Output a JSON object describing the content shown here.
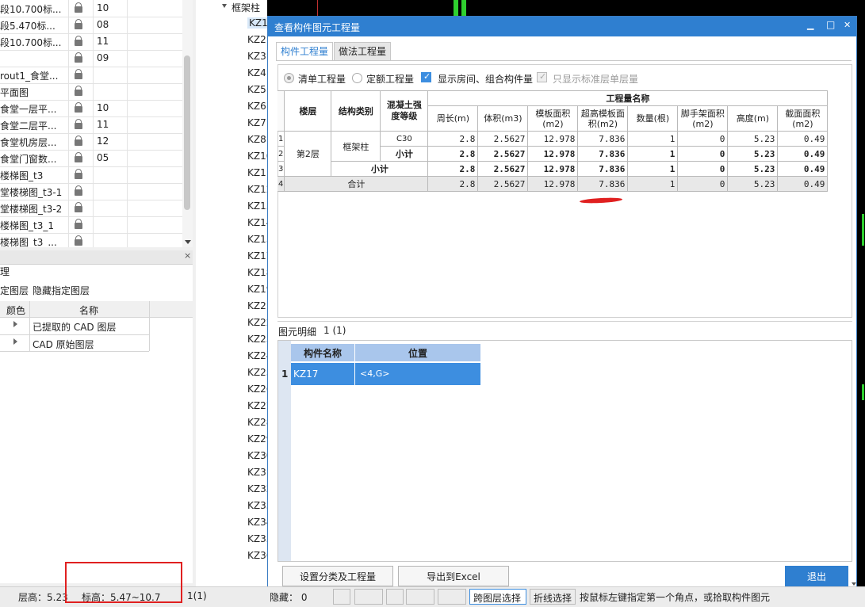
{
  "drawings": [
    {
      "name": "段10.700标...",
      "num": "10"
    },
    {
      "name": "段5.470标...",
      "num": "08"
    },
    {
      "name": "段10.700标...",
      "num": "11"
    },
    {
      "name": "",
      "num": "09"
    },
    {
      "name": "rout1_食堂...",
      "num": ""
    },
    {
      "name": "平面图",
      "num": ""
    },
    {
      "name": "食堂一层平...",
      "num": "10"
    },
    {
      "name": "食堂二层平...",
      "num": "11"
    },
    {
      "name": "食堂机房层...",
      "num": "12"
    },
    {
      "name": "食堂门窗数...",
      "num": "05"
    },
    {
      "name": "楼梯图_t3",
      "num": ""
    },
    {
      "name": "堂楼梯图_t3-1",
      "num": ""
    },
    {
      "name": "堂楼梯图_t3-2",
      "num": ""
    },
    {
      "name": "楼梯图_t3_1",
      "num": ""
    },
    {
      "name": "楼梯图_t3_...",
      "num": ""
    }
  ],
  "layer_panel": {
    "title": "理",
    "close": "×",
    "toolbar_show": "定图层",
    "toolbar_hide": "隐藏指定图层",
    "col_color": "颜色",
    "col_name": "名称",
    "rows": [
      "已提取的 CAD 图层",
      "CAD 原始图层"
    ]
  },
  "tree": {
    "parent": "框架柱",
    "items": [
      "KZ1",
      "KZ2",
      "KZ3",
      "KZ4",
      "KZ5",
      "KZ6",
      "KZ7",
      "KZ8",
      "KZ10",
      "KZ11",
      "KZ12",
      "KZ13",
      "KZ14",
      "KZ15",
      "KZ17",
      "KZ18",
      "KZ19",
      "KZ21",
      "KZ22",
      "KZ23",
      "KZ24",
      "KZ25",
      "KZ26",
      "KZ27",
      "KZ28",
      "KZ29",
      "KZ30",
      "KZ31",
      "KZ32",
      "KZ33",
      "KZ34",
      "KZ35",
      "KZ36"
    ]
  },
  "dialog": {
    "title": "查看构件图元工程量",
    "minimize": "▁",
    "maximize": "□",
    "close": "✕",
    "tabs": [
      "构件工程量",
      "做法工程量"
    ],
    "options": {
      "qd": "清单工程量",
      "de": "定额工程量",
      "show_room": "显示房间、组合构件量",
      "std_only": "只显示标准层单层量"
    },
    "table": {
      "h_floor": "楼层",
      "h_type": "结构类别",
      "h_grade": "混凝土强度等级",
      "h_group": "工程量名称",
      "cols": [
        "周长(m)",
        "体积(m3)",
        "模板面积(m2)",
        "超高模板面积(m2)",
        "数量(根)",
        "脚手架面积(m2)",
        "高度(m)",
        "截面面积(m2)"
      ],
      "floor": "第2层",
      "type": "框架柱",
      "grade": "C30",
      "subtotal": "小计",
      "total": "合计",
      "rownums": [
        "1",
        "2",
        "3",
        "4"
      ],
      "values": [
        "2.8",
        "2.5627",
        "12.978",
        "7.836",
        "1",
        "0",
        "5.23",
        "0.49"
      ]
    },
    "detail": {
      "title": "图元明细",
      "count": "1 (1)",
      "col_name": "构件名称",
      "col_pos": "位置",
      "rownum": "1",
      "name": "KZ17",
      "pos": "<4,G>"
    },
    "buttons": {
      "setup": "设置分类及工程量",
      "export": "导出到Excel",
      "exit": "退出"
    }
  },
  "status": {
    "floor_h": "层高：5.23",
    "elev": "标高：5.47~10.7",
    "count": "1(1)",
    "hidden": "隐藏： 0",
    "cross_layer": "跨图层选择",
    "polyline": "折线选择",
    "hint": "按鼠标左键指定第一个角点，或拾取构件图元"
  },
  "colors": {
    "title_bar": "#2f7fd0",
    "selection": "#3d8ee0",
    "header_blue": "#a9c6ec",
    "annotation_red": "#e02020",
    "highlight_green": "#2fd02f"
  }
}
